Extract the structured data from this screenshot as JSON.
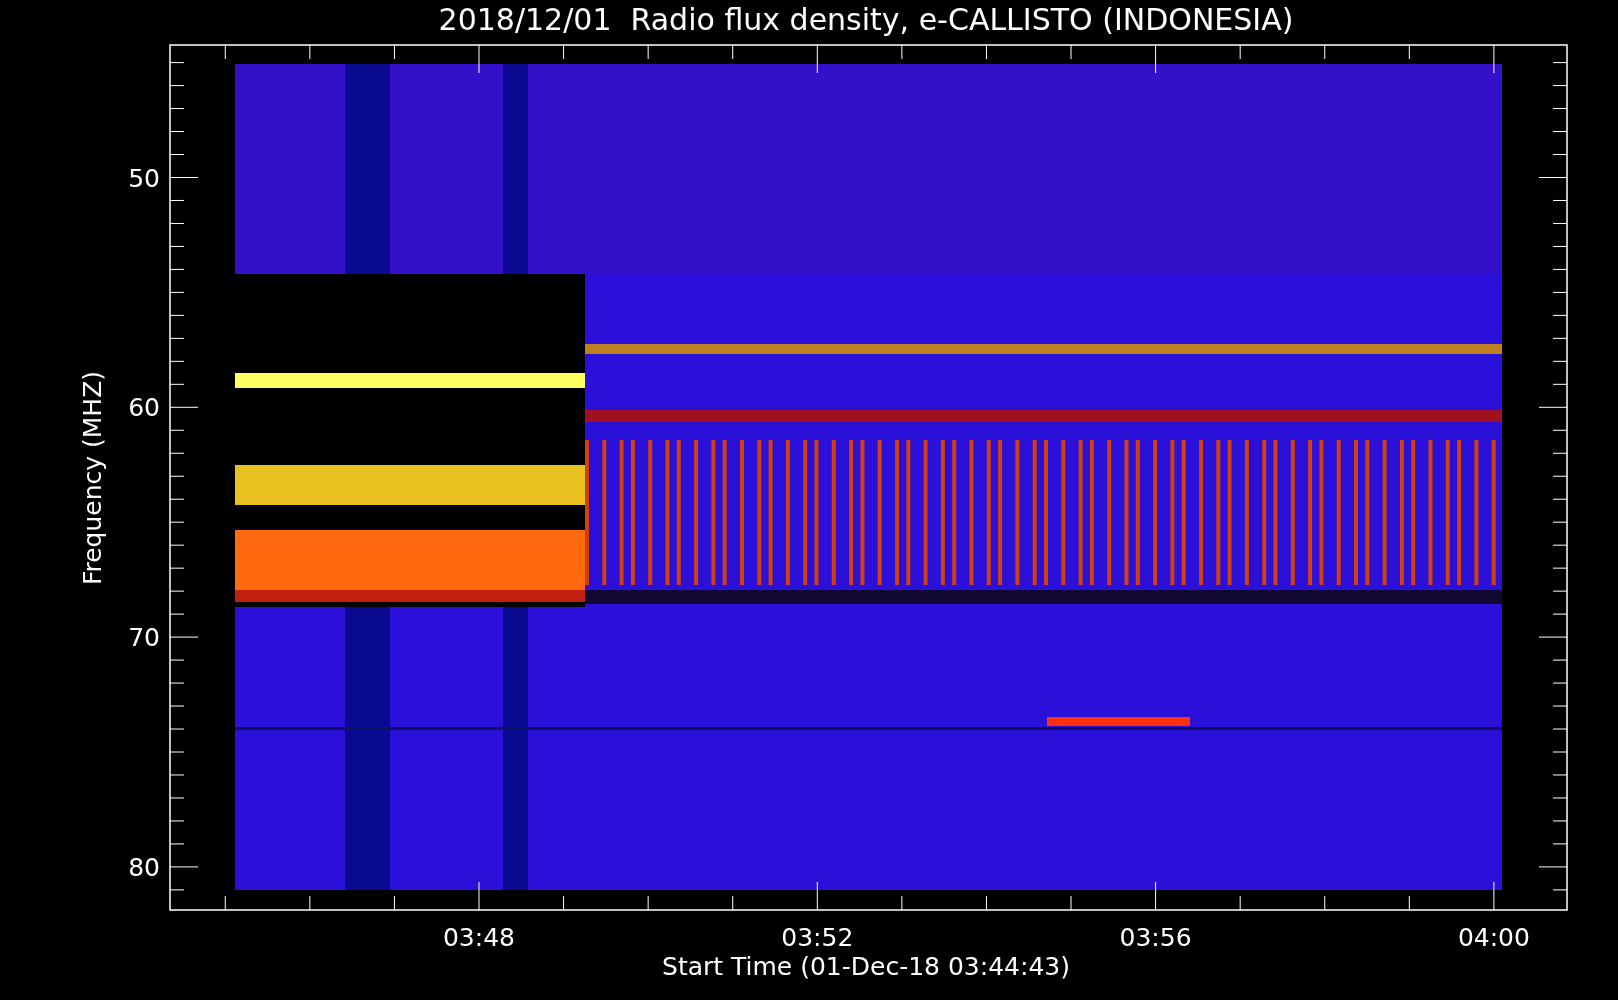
{
  "title": "2018/12/01  Radio flux density, e-CALLISTO (INDONESIA)",
  "y_axis": {
    "label": "Frequency (MHZ)",
    "ticks": [
      "50",
      "60",
      "70",
      "80"
    ]
  },
  "x_axis": {
    "label": "Start Time (01-Dec-18 03:44:43)",
    "ticks": [
      "03:48",
      "03:52",
      "03:56",
      "04:00"
    ]
  }
}
